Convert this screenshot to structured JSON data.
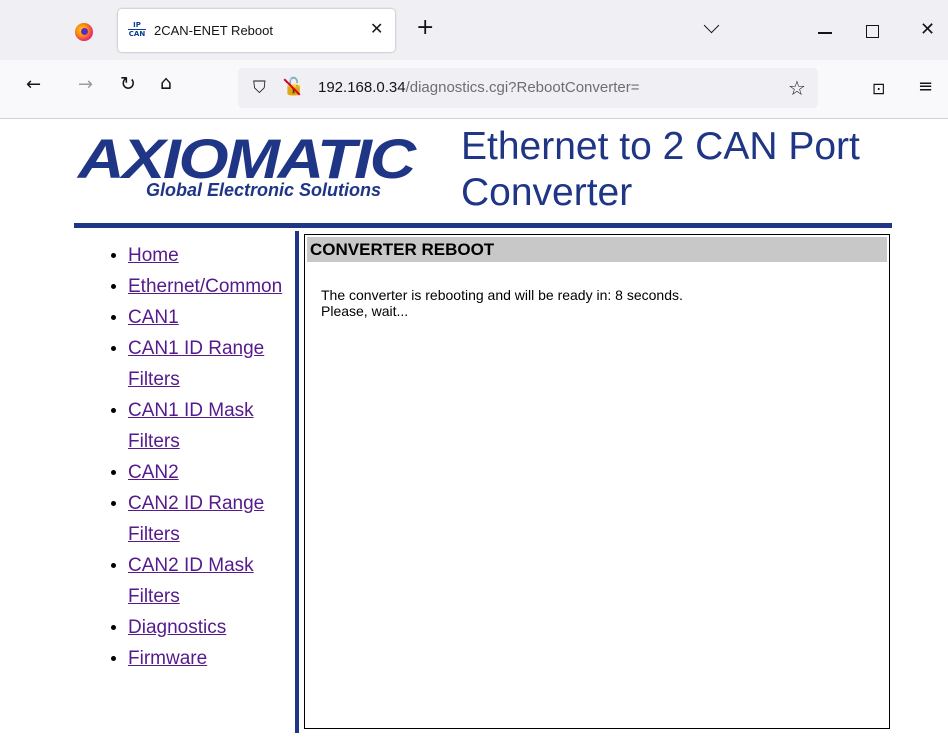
{
  "browser": {
    "tab_title": "2CAN-ENET Reboot",
    "tab_favicon_top": "IP",
    "tab_favicon_bottom": "CAN",
    "url_host": "192.168.0.34",
    "url_path": "/diagnostics.cgi?RebootConverter=",
    "icons": [
      "firefox-logo",
      "close-icon",
      "plus-icon",
      "chevron-down-icon",
      "minimize-icon",
      "maximize-icon",
      "close-icon",
      "back-arrow-icon",
      "forward-arrow-icon",
      "reload-icon",
      "home-icon",
      "shield-icon",
      "lock-slash-icon",
      "star-icon",
      "pocket-icon",
      "hamburger-menu-icon"
    ]
  },
  "page": {
    "logo_text": "AXIOMATIC",
    "logo_subtitle": "Global Electronic Solutions",
    "title": "Ethernet to 2 CAN Port Converter",
    "brand_color": "#1f3585",
    "nav": [
      {
        "label": "Home"
      },
      {
        "label": "Ethernet/Common"
      },
      {
        "label": "CAN1"
      },
      {
        "label": "CAN1 ID Range Filters"
      },
      {
        "label": "CAN1 ID Mask Filters"
      },
      {
        "label": "CAN2"
      },
      {
        "label": "CAN2 ID Range Filters"
      },
      {
        "label": "CAN2 ID Mask Filters"
      },
      {
        "label": "Diagnostics"
      },
      {
        "label": "Firmware"
      }
    ],
    "section_header": "CONVERTER REBOOT",
    "message_line1": "The converter is rebooting and will be ready in: 8 seconds.",
    "message_line2": "Please, wait..."
  }
}
